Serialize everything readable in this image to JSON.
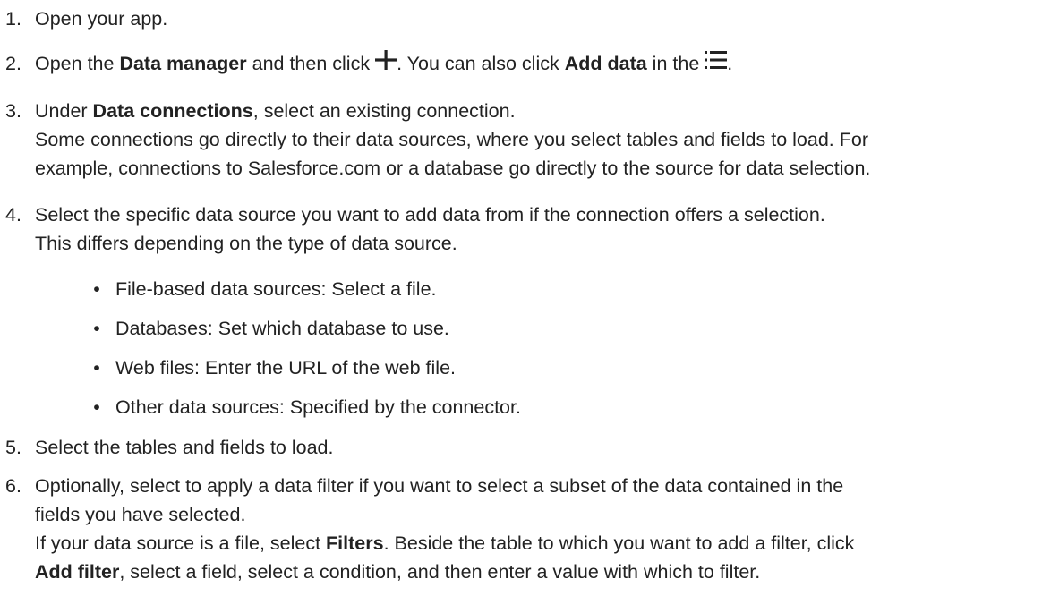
{
  "steps": [
    {
      "number": "1.",
      "lines": [
        {
          "text": "Open your app."
        }
      ]
    },
    {
      "number": "2.",
      "lines": [
        {
          "t1": "Open the ",
          "b1": "Data manager",
          "t2": " and then click ",
          "icon1": "plus-icon",
          "t3": ". You can also click ",
          "b2": "Add data",
          "t4": " in the ",
          "icon2": "menu-list-icon",
          "t5": "."
        }
      ]
    },
    {
      "number": "3.",
      "lines": [
        {
          "t1": "Under ",
          "b1": "Data connections",
          "t2": ", select an existing connection."
        },
        {
          "text": "Some connections go directly to their data sources, where you select tables and fields to load. For"
        },
        {
          "text": "example, connections to Salesforce.com or a database go directly to the source for data selection."
        }
      ]
    },
    {
      "number": "4.",
      "lines": [
        {
          "text": "Select the specific data source you want to add data from if the connection offers a selection."
        },
        {
          "text": "This differs depending on the type of data source."
        }
      ],
      "bullets": [
        "File-based data sources: Select a file.",
        "Databases: Set which database to use.",
        "Web files: Enter the URL of the web file.",
        "Other data sources: Specified by the connector."
      ]
    },
    {
      "number": "5.",
      "lines": [
        {
          "text": "Select the tables and fields to load."
        }
      ]
    },
    {
      "number": "6.",
      "lines": [
        {
          "text": "Optionally, select to apply a data filter if you want to select a subset of the data contained in the"
        },
        {
          "text": "fields you have selected."
        },
        {
          "t1": "If your data source is a file, select ",
          "b1": "Filters",
          "t2": ". Beside the table to which you want to add a filter, click"
        },
        {
          "b1": "Add filter",
          "t1": ", select a field, select a condition, and then enter a value with which to filter."
        }
      ]
    }
  ],
  "bullet_symbol": "•"
}
